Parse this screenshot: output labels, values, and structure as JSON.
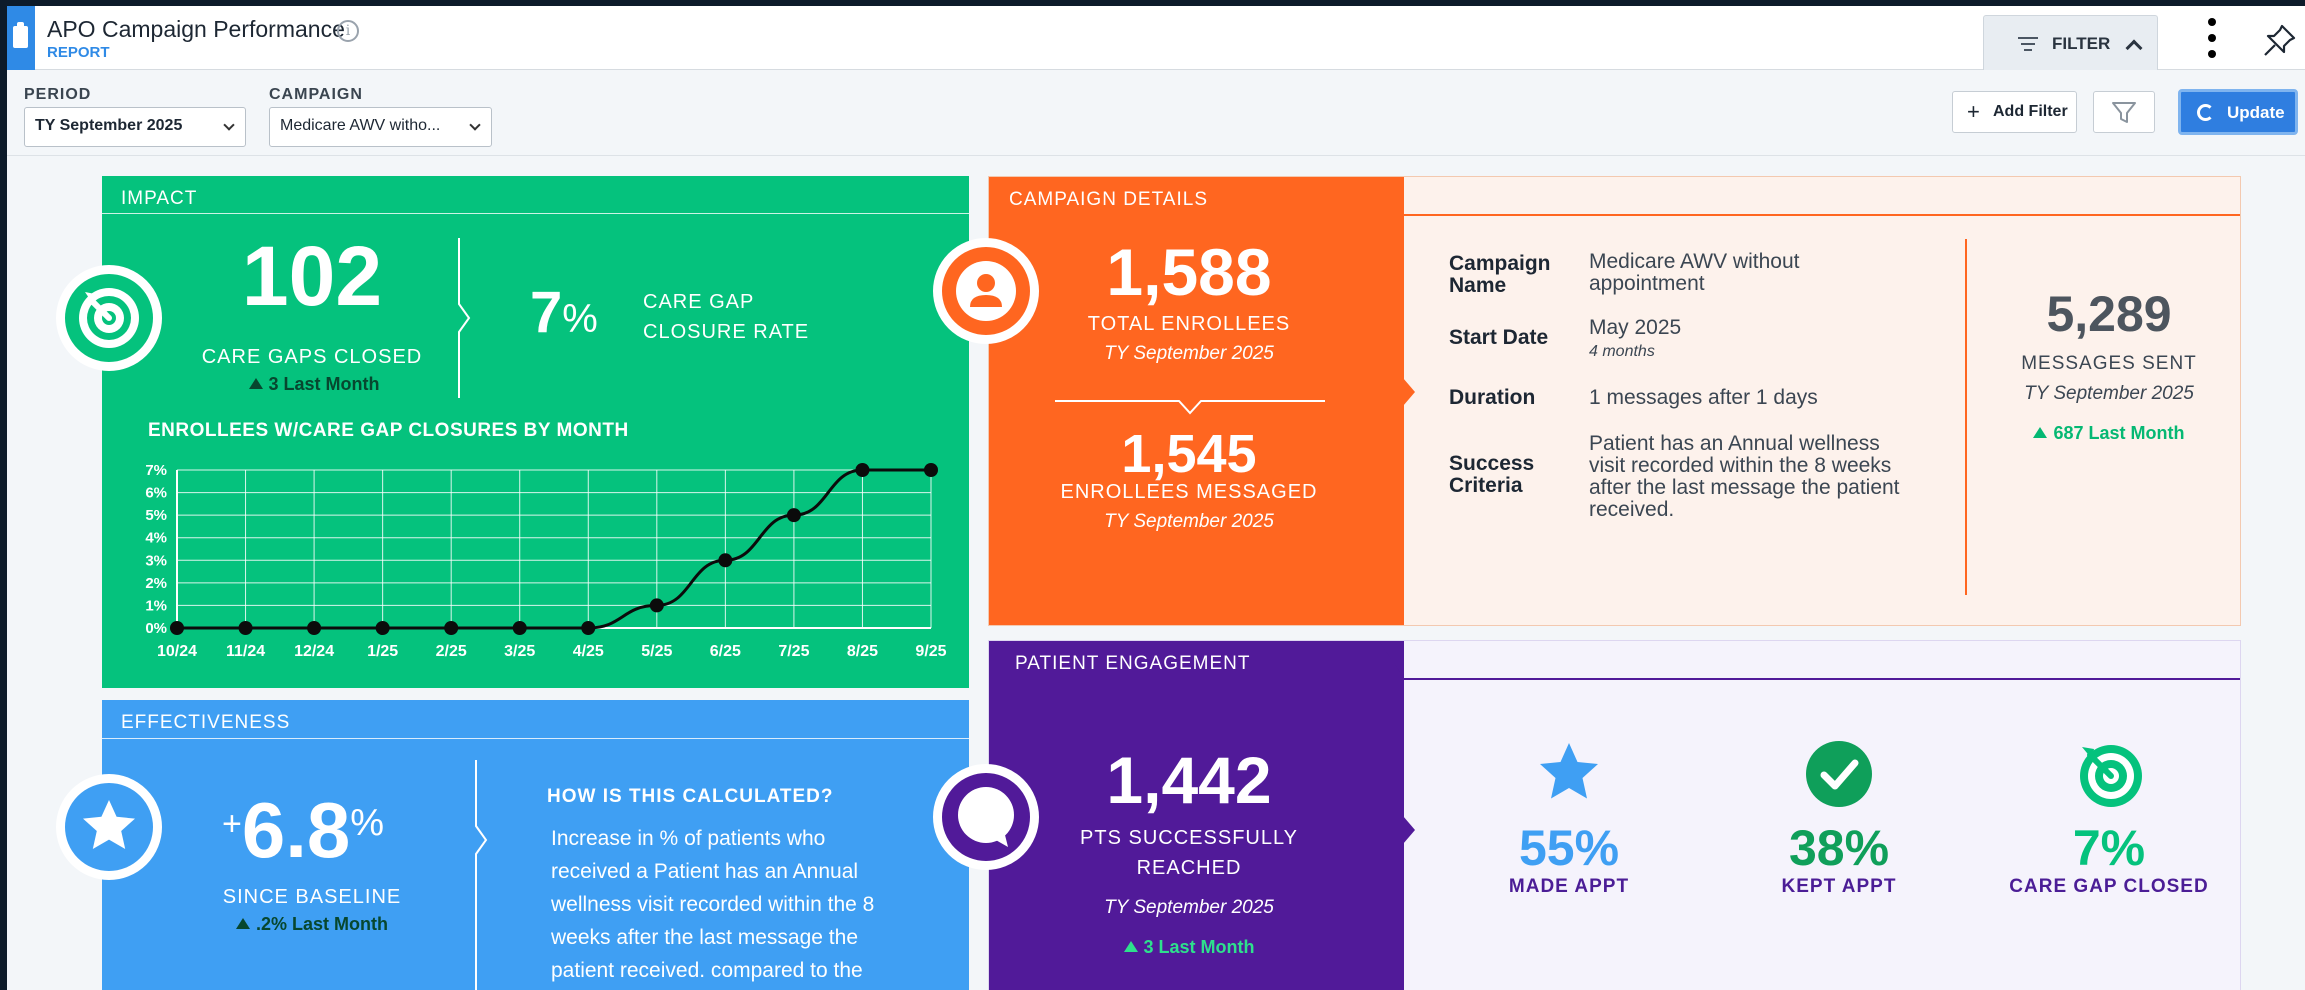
{
  "header": {
    "title": "APO Campaign Performance",
    "subtitle": "REPORT",
    "filter_tab_label": "FILTER"
  },
  "filters": {
    "period_label": "PERIOD",
    "period_value": "TY September 2025",
    "campaign_label": "CAMPAIGN",
    "campaign_value": "Medicare AWV witho...",
    "add_filter_label": "Add Filter",
    "update_label": "Update"
  },
  "impact": {
    "title": "IMPACT",
    "care_gaps_closed": "102",
    "care_gaps_closed_label": "CARE GAPS CLOSED",
    "care_gaps_change": "3 Last Month",
    "closure_rate_value": "7",
    "closure_rate_unit": "%",
    "closure_rate_label_1": "CARE GAP",
    "closure_rate_label_2": "CLOSURE RATE"
  },
  "chart_data": {
    "type": "line",
    "title": "ENROLLEES W/CARE GAP CLOSURES BY MONTH",
    "categories": [
      "10/24",
      "11/24",
      "12/24",
      "1/25",
      "2/25",
      "3/25",
      "4/25",
      "5/25",
      "6/25",
      "7/25",
      "8/25",
      "9/25"
    ],
    "values": [
      0,
      0,
      0,
      0,
      0,
      0,
      0,
      1,
      3,
      5,
      7,
      7
    ],
    "y_ticks": [
      "0%",
      "1%",
      "2%",
      "3%",
      "4%",
      "5%",
      "6%",
      "7%"
    ],
    "ylim": [
      0,
      7
    ],
    "grid": true,
    "line_color": "#0b0b0b",
    "grid_color": "#ffffff"
  },
  "effectiveness": {
    "title": "EFFECTIVENESS",
    "sign": "+",
    "value": "6.8",
    "unit": "%",
    "label": "SINCE BASELINE",
    "change": ".2% Last Month",
    "how_title": "HOW IS THIS CALCULATED?",
    "how_lines": [
      "Increase in % of patients who",
      "received a Patient has an Annual",
      "wellness visit recorded within the 8",
      "weeks after the last message the",
      "patient received. compared to the"
    ]
  },
  "campaign": {
    "title": "CAMPAIGN DETAILS",
    "total_enrollees": "1,588",
    "total_enrollees_label": "TOTAL ENROLLEES",
    "total_enrollees_period": "TY September 2025",
    "enrollees_messaged": "1,545",
    "enrollees_messaged_label": "ENROLLEES MESSAGED",
    "enrollees_messaged_period": "TY September 2025",
    "details": {
      "name_label_1": "Campaign",
      "name_label_2": "Name",
      "name_value_1": "Medicare AWV without",
      "name_value_2": "appointment",
      "start_label": "Start Date",
      "start_value": "May 2025",
      "start_sub": "4 months",
      "duration_label": "Duration",
      "duration_value": "1 messages after 1 days",
      "criteria_label_1": "Success",
      "criteria_label_2": "Criteria",
      "criteria_lines": [
        "Patient has an Annual wellness",
        "visit recorded within the 8 weeks",
        "after the last message the patient",
        "received."
      ]
    },
    "messages_sent": "5,289",
    "messages_sent_label": "MESSAGES SENT",
    "messages_sent_period": "TY September 2025",
    "messages_change": "687 Last Month"
  },
  "engagement": {
    "title": "PATIENT ENGAGEMENT",
    "reached": "1,442",
    "reached_label_1": "PTS SUCCESSFULLY",
    "reached_label_2": "REACHED",
    "reached_period": "TY September 2025",
    "reached_change": "3 Last Month",
    "metrics": [
      {
        "value": "55%",
        "label": "MADE APPT",
        "color": "#3f9ff3",
        "icon": "star-icon"
      },
      {
        "value": "38%",
        "label": "KEPT APPT",
        "color": "#0f9f5a",
        "icon": "check-icon"
      },
      {
        "value": "7%",
        "label": "CARE GAP CLOSED",
        "color": "#05c27d",
        "icon": "target-icon"
      }
    ]
  },
  "colors": {
    "impact": "#05c27d",
    "effectiveness": "#3f9ff3",
    "campaign": "#ff6620",
    "engagement": "#511a99",
    "accent_blue": "#2f8ae6"
  }
}
